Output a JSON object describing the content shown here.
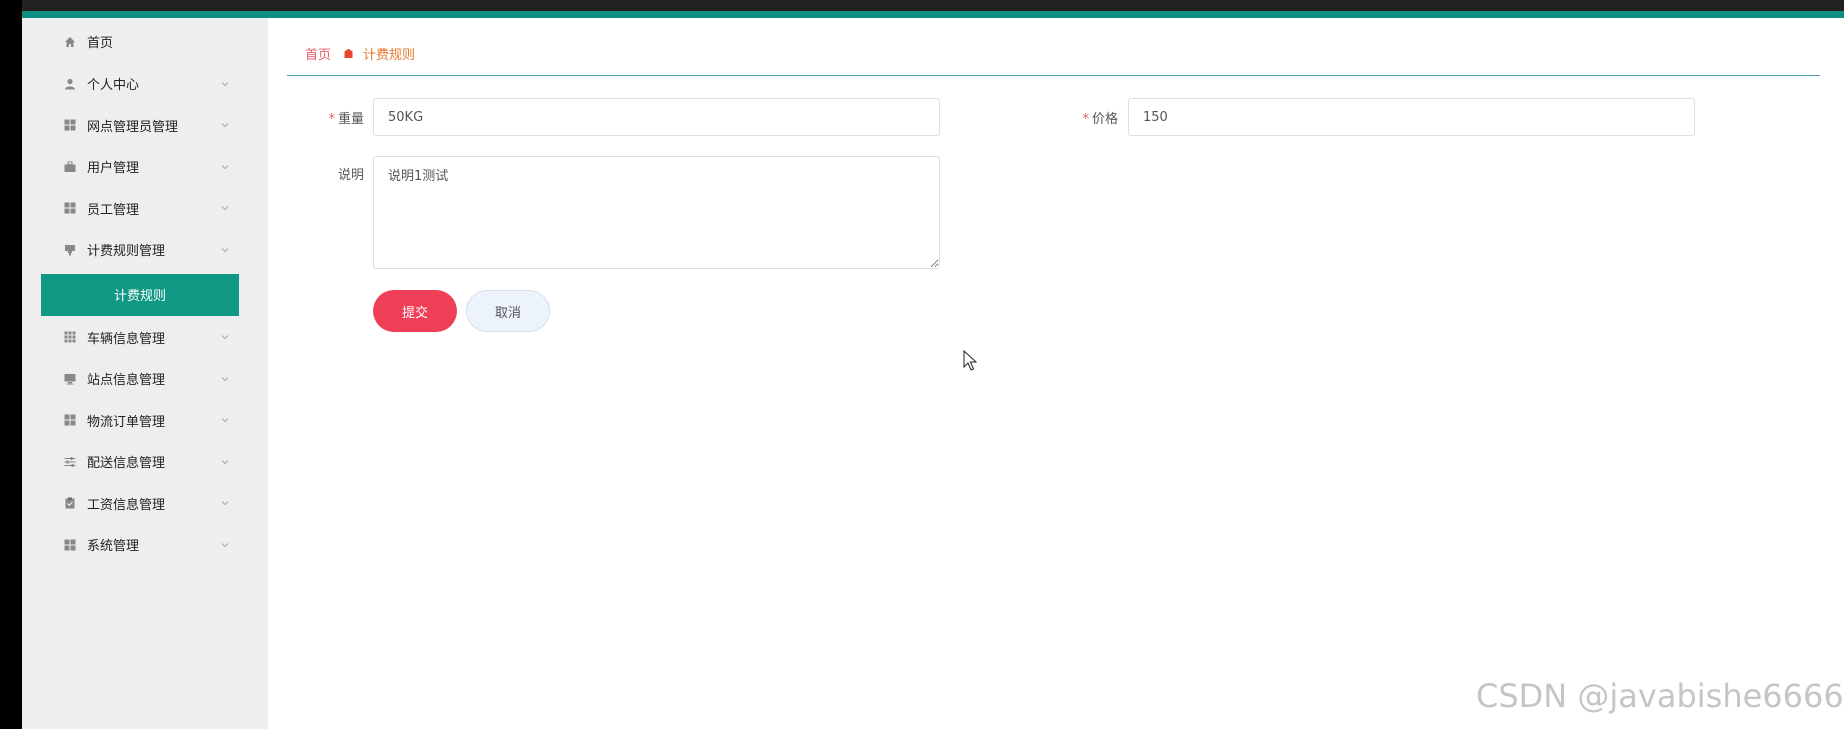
{
  "sidebar": {
    "items": [
      {
        "label": "首页",
        "icon": "home-icon",
        "has_children": false
      },
      {
        "label": "个人中心",
        "icon": "user-icon",
        "has_children": true
      },
      {
        "label": "网点管理员管理",
        "icon": "grid-icon",
        "has_children": true
      },
      {
        "label": "用户管理",
        "icon": "briefcase-icon",
        "has_children": true
      },
      {
        "label": "员工管理",
        "icon": "grid-icon",
        "has_children": true
      },
      {
        "label": "计费规则管理",
        "icon": "flag-icon",
        "has_children": true
      },
      {
        "label": "车辆信息管理",
        "icon": "apps-icon",
        "has_children": true
      },
      {
        "label": "站点信息管理",
        "icon": "monitor-icon",
        "has_children": true
      },
      {
        "label": "物流订单管理",
        "icon": "grid-icon",
        "has_children": true
      },
      {
        "label": "配送信息管理",
        "icon": "sliders-icon",
        "has_children": true
      },
      {
        "label": "工资信息管理",
        "icon": "clipboard-icon",
        "has_children": true
      },
      {
        "label": "系统管理",
        "icon": "grid-icon",
        "has_children": true
      }
    ],
    "active_sub": {
      "label": "计费规则"
    }
  },
  "breadcrumb": {
    "home": "首页",
    "current": "计费规则"
  },
  "form": {
    "weight": {
      "label": "重量",
      "required": "*",
      "value": "50KG"
    },
    "price": {
      "label": "价格",
      "required": "*",
      "value": "150"
    },
    "description": {
      "label": "说明",
      "value": "说明1测试"
    },
    "submit_label": "提交",
    "cancel_label": "取消"
  },
  "watermark": "CSDN @javabishe6666",
  "colors": {
    "accent": "#0f9884",
    "primary_button": "#ef3f58",
    "breadcrumb_home": "#e45a6a",
    "breadcrumb_current": "#e4772e"
  }
}
